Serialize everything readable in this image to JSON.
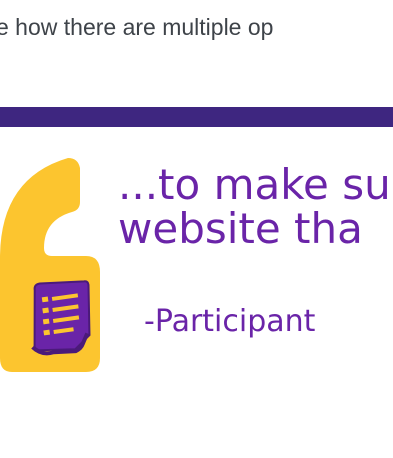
{
  "intro": {
    "text": "e how there are multiple op"
  },
  "quote": {
    "line1": "...to make su",
    "line2": "website tha",
    "attribution": "-Participant"
  },
  "icons": {
    "quote_mark": "quotation-mark-icon",
    "document": "document-icon"
  },
  "colors": {
    "divider": "#3e2680",
    "quote_mark": "#fcc52f",
    "quote_text": "#6a24a8",
    "body_text": "#3e4349"
  }
}
